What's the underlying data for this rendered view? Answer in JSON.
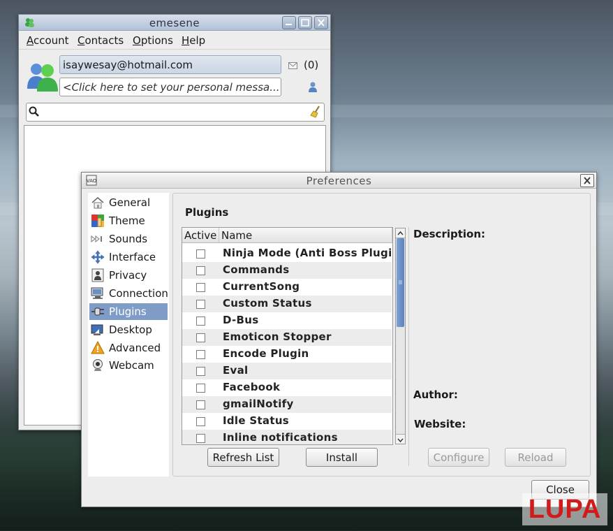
{
  "emesene": {
    "title": "emesene",
    "menu": [
      {
        "label": "Account",
        "u": "A",
        "rest": "ccount"
      },
      {
        "label": "Contacts",
        "u": "C",
        "rest": "ontacts"
      },
      {
        "label": "Options",
        "u": "O",
        "rest": "ptions"
      },
      {
        "label": "Help",
        "u": "H",
        "rest": "elp"
      }
    ],
    "account_email": "isaywesay@hotmail.com",
    "mail_count": "(0)",
    "personal_message_placeholder": "<Click here to set your personal messa...",
    "search_placeholder": ""
  },
  "prefs": {
    "title": "Preferences",
    "categories": [
      {
        "label": "General",
        "icon": "home-icon"
      },
      {
        "label": "Theme",
        "icon": "palette-icon"
      },
      {
        "label": "Sounds",
        "icon": "speaker-icon"
      },
      {
        "label": "Interface",
        "icon": "move-arrows-icon"
      },
      {
        "label": "Privacy",
        "icon": "user-lock-icon"
      },
      {
        "label": "Connection",
        "icon": "monitor-icon"
      },
      {
        "label": "Plugins",
        "icon": "plug-icon",
        "selected": true
      },
      {
        "label": "Desktop",
        "icon": "desktop-icon"
      },
      {
        "label": "Advanced",
        "icon": "warning-icon"
      },
      {
        "label": "Webcam",
        "icon": "webcam-icon"
      }
    ],
    "section_title": "Plugins",
    "columns": {
      "active": "Active",
      "name": "Name"
    },
    "plugins": [
      "Ninja Mode (Anti Boss Plugin)",
      "Commands",
      "CurrentSong",
      "Custom Status",
      "D-Bus",
      "Emoticon Stopper",
      "Encode Plugin",
      "Eval",
      "Facebook",
      "gmailNotify",
      "Idle Status",
      "Inline notifications"
    ],
    "description_label": "Description:",
    "author_label": "Author:",
    "website_label": "Website:",
    "buttons": {
      "refresh": "Refresh List",
      "install": "Install",
      "configure": "Configure",
      "reload": "Reload",
      "close": "Close"
    }
  },
  "watermark": "LUPA"
}
